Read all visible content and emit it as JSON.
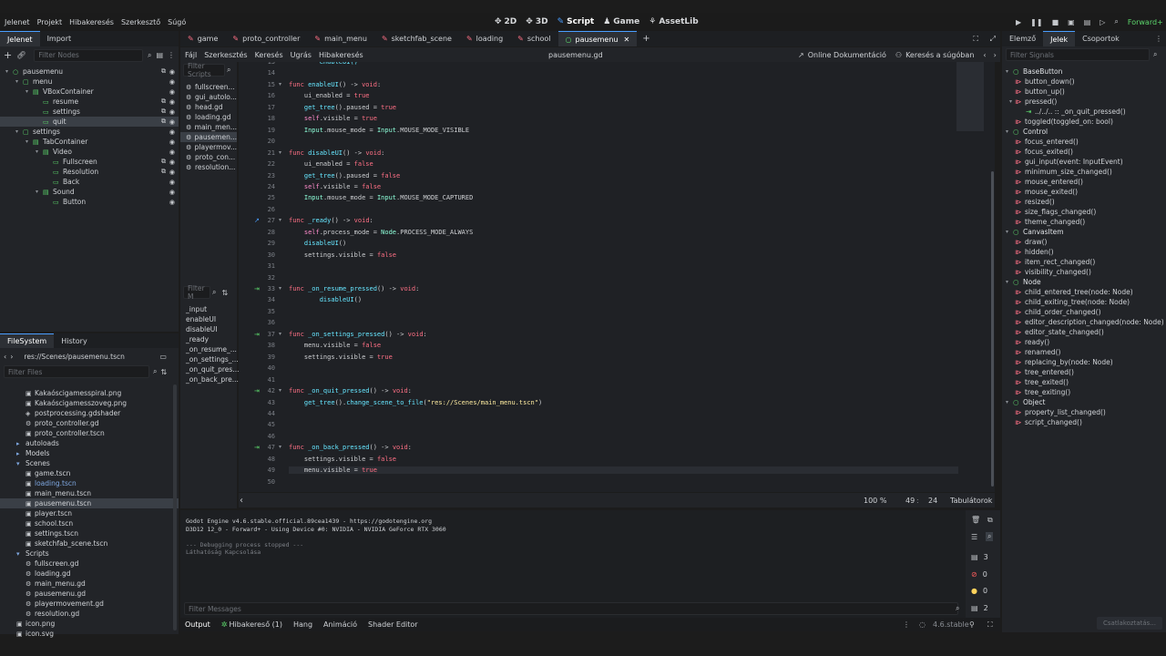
{
  "menu": [
    "Jelenet",
    "Projekt",
    "Hibakeresés",
    "Szerkesztő",
    "Súgó"
  ],
  "workspaces": [
    {
      "label": "2D",
      "icon": "✥"
    },
    {
      "label": "3D",
      "icon": "✥"
    },
    {
      "label": "Script",
      "icon": "✎"
    },
    {
      "label": "Game",
      "icon": "♟"
    },
    {
      "label": "AssetLib",
      "icon": "⚘"
    }
  ],
  "renderer": "Forward+",
  "left_tabs": [
    "Jelenet",
    "Import"
  ],
  "filter_nodes": "Filter Nodes",
  "scene_tree": [
    {
      "label": "pausemenu",
      "indent": 0,
      "icon": "○",
      "color": "#5cd66b"
    },
    {
      "label": "menu",
      "indent": 1,
      "icon": "▢",
      "color": "#5cd66b"
    },
    {
      "label": "VBoxContainer",
      "indent": 2,
      "icon": "▤",
      "color": "#5cd66b"
    },
    {
      "label": "resume",
      "indent": 3,
      "icon": "▭",
      "color": "#5cd66b"
    },
    {
      "label": "settings",
      "indent": 3,
      "icon": "▭",
      "color": "#5cd66b"
    },
    {
      "label": "quit",
      "indent": 3,
      "icon": "▭",
      "color": "#5cd66b",
      "selected": true
    },
    {
      "label": "settings",
      "indent": 1,
      "icon": "▢",
      "color": "#5cd66b"
    },
    {
      "label": "TabContainer",
      "indent": 2,
      "icon": "▤",
      "color": "#5cd66b"
    },
    {
      "label": "Video",
      "indent": 3,
      "icon": "▤",
      "color": "#5cd66b"
    },
    {
      "label": "Fullscreen",
      "indent": 4,
      "icon": "▭",
      "color": "#5cd66b"
    },
    {
      "label": "Resolution",
      "indent": 4,
      "icon": "▭",
      "color": "#5cd66b"
    },
    {
      "label": "Back",
      "indent": 4,
      "icon": "▭",
      "color": "#5cd66b"
    },
    {
      "label": "Sound",
      "indent": 3,
      "icon": "▤",
      "color": "#5cd66b"
    },
    {
      "label": "Button",
      "indent": 4,
      "icon": "▭",
      "color": "#5cd66b"
    }
  ],
  "fs_tabs": [
    "FileSystem",
    "History"
  ],
  "fs_path": "res://Scenes/pausemenu.tscn",
  "filter_files": "Filter Files",
  "fs_items": [
    {
      "label": "Kakaóscigamesspiral.png",
      "indent": 2,
      "icon": "▣"
    },
    {
      "label": "Kakaóscigamesszoveg.png",
      "indent": 2,
      "icon": "▣"
    },
    {
      "label": "postprocessing.gdshader",
      "indent": 2,
      "icon": "◈"
    },
    {
      "label": "proto_controller.gd",
      "indent": 2,
      "icon": "⚙"
    },
    {
      "label": "proto_controller.tscn",
      "indent": 2,
      "icon": "▣"
    },
    {
      "label": "autoloads",
      "indent": 1,
      "icon": "▸",
      "folder": true
    },
    {
      "label": "Models",
      "indent": 1,
      "icon": "▸",
      "folder": true
    },
    {
      "label": "Scenes",
      "indent": 1,
      "icon": "▾",
      "folder": true
    },
    {
      "label": "game.tscn",
      "indent": 2,
      "icon": "▣"
    },
    {
      "label": "loading.tscn",
      "indent": 2,
      "icon": "▣",
      "blue": true
    },
    {
      "label": "main_menu.tscn",
      "indent": 2,
      "icon": "▣"
    },
    {
      "label": "pausemenu.tscn",
      "indent": 2,
      "icon": "▣",
      "selected": true
    },
    {
      "label": "player.tscn",
      "indent": 2,
      "icon": "▣"
    },
    {
      "label": "school.tscn",
      "indent": 2,
      "icon": "▣"
    },
    {
      "label": "settings.tscn",
      "indent": 2,
      "icon": "▣"
    },
    {
      "label": "sketchfab_scene.tscn",
      "indent": 2,
      "icon": "▣"
    },
    {
      "label": "Scripts",
      "indent": 1,
      "icon": "▾",
      "folder": true
    },
    {
      "label": "fullscreen.gd",
      "indent": 2,
      "icon": "⚙"
    },
    {
      "label": "loading.gd",
      "indent": 2,
      "icon": "⚙"
    },
    {
      "label": "main_menu.gd",
      "indent": 2,
      "icon": "⚙"
    },
    {
      "label": "pausemenu.gd",
      "indent": 2,
      "icon": "⚙"
    },
    {
      "label": "playermovement.gd",
      "indent": 2,
      "icon": "⚙"
    },
    {
      "label": "resolution.gd",
      "indent": 2,
      "icon": "⚙"
    },
    {
      "label": "icon.png",
      "indent": 1,
      "icon": "▣"
    },
    {
      "label": "icon.svg",
      "indent": 1,
      "icon": "▣"
    }
  ],
  "scene_tabs": [
    "game",
    "proto_controller",
    "main_menu",
    "sketchfab_scene",
    "loading",
    "school",
    "pausemenu"
  ],
  "active_scene_tab": 6,
  "script_menu": [
    "Fájl",
    "Szerkesztés",
    "Keresés",
    "Ugrás",
    "Hibakeresés"
  ],
  "script_file": "pausemenu.gd",
  "online_docs": "Online Dokumentáció",
  "help_search": "Keresés a súgóban",
  "filter_scripts": "Filter Scripts",
  "scripts": [
    "fullscreen...",
    "gui_autolo...",
    "head.gd",
    "loading.gd",
    "main_men...",
    "pausemen...",
    "playermov...",
    "proto_con...",
    "resolution..."
  ],
  "active_script": 5,
  "filter_methods": "Filter M",
  "methods": [
    "_input",
    "enableUI",
    "disableUI",
    "_ready",
    "_on_resume_...",
    "_on_settings_...",
    "_on_quit_pres...",
    "_on_back_pre..."
  ],
  "code": [
    {
      "n": "13",
      "t": "        enableUI()",
      "cls": "fn"
    },
    {
      "n": "14",
      "t": ""
    },
    {
      "n": "15",
      "fold": true,
      "h": "<span class='kw'>func</span> <span class='fn'>enableUI</span>() -> <span class='kw'>void</span>:"
    },
    {
      "n": "16",
      "h": "    ui_enabled = <span class='kw'>true</span>"
    },
    {
      "n": "17",
      "h": "    <span class='fn'>get_tree</span>().paused = <span class='kw'>true</span>"
    },
    {
      "n": "18",
      "h": "    <span class='sf'>self</span>.visible = <span class='kw'>true</span>"
    },
    {
      "n": "19",
      "h": "    <span class='ty'>Input</span>.mouse_mode = <span class='ty'>Input</span>.MOUSE_MODE_VISIBLE"
    },
    {
      "n": "20",
      "t": ""
    },
    {
      "n": "21",
      "fold": true,
      "h": "<span class='kw'>func</span> <span class='fn'>disableUI</span>() -> <span class='kw'>void</span>:"
    },
    {
      "n": "22",
      "h": "    ui_enabled = <span class='kw'>false</span>"
    },
    {
      "n": "23",
      "h": "    <span class='fn'>get_tree</span>().paused = <span class='kw'>false</span>"
    },
    {
      "n": "24",
      "h": "    <span class='sf'>self</span>.visible = <span class='kw'>false</span>"
    },
    {
      "n": "25",
      "h": "    <span class='ty'>Input</span>.mouse_mode = <span class='ty'>Input</span>.MOUSE_MODE_CAPTURED"
    },
    {
      "n": "26",
      "t": ""
    },
    {
      "n": "27",
      "fold": true,
      "mark": "↗",
      "h": "<span class='kw'>func</span> <span class='fn'>_ready</span>() -> <span class='kw'>void</span>:"
    },
    {
      "n": "28",
      "h": "    <span class='sf'>self</span>.process_mode = <span class='ty'>Node</span>.PROCESS_MODE_ALWAYS"
    },
    {
      "n": "29",
      "h": "    <span class='fn'>disableUI</span>()"
    },
    {
      "n": "30",
      "h": "    settings.visible = <span class='kw'>false</span>"
    },
    {
      "n": "31",
      "t": ""
    },
    {
      "n": "32",
      "t": ""
    },
    {
      "n": "33",
      "fold": true,
      "mark": "⇥",
      "h": "<span class='kw'>func</span> <span class='fn'>_on_resume_pressed</span>() -> <span class='kw'>void</span>:"
    },
    {
      "n": "34",
      "h": "        <span class='fn'>disableUI</span>()"
    },
    {
      "n": "35",
      "t": ""
    },
    {
      "n": "36",
      "t": ""
    },
    {
      "n": "37",
      "fold": true,
      "mark": "⇥",
      "h": "<span class='kw'>func</span> <span class='fn'>_on_settings_pressed</span>() -> <span class='kw'>void</span>:"
    },
    {
      "n": "38",
      "h": "    menu.visible = <span class='kw'>false</span>"
    },
    {
      "n": "39",
      "h": "    settings.visible = <span class='kw'>true</span>"
    },
    {
      "n": "40",
      "t": ""
    },
    {
      "n": "41",
      "t": ""
    },
    {
      "n": "42",
      "fold": true,
      "mark": "⇥",
      "h": "<span class='kw'>func</span> <span class='fn'>_on_quit_pressed</span>() -> <span class='kw'>void</span>:"
    },
    {
      "n": "43",
      "h": "    <span class='fn'>get_tree</span>().<span class='fn'>change_scene_to_file</span>(<span class='st'>\"res://Scenes/main_menu.tscn\"</span>)"
    },
    {
      "n": "44",
      "t": ""
    },
    {
      "n": "45",
      "t": ""
    },
    {
      "n": "46",
      "t": ""
    },
    {
      "n": "47",
      "fold": true,
      "mark": "⇥",
      "h": "<span class='kw'>func</span> <span class='fn'>_on_back_pressed</span>() -> <span class='kw'>void</span>:"
    },
    {
      "n": "48",
      "h": "    settings.visible = <span class='kw'>false</span>"
    },
    {
      "n": "49",
      "cur": true,
      "h": "    menu.visible = <span class='kw'>true</span>"
    },
    {
      "n": "50",
      "t": ""
    }
  ],
  "status": {
    "zoom": "100 %",
    "line": "49",
    "col": "24",
    "indent": "Tabulátorok"
  },
  "output_lines": [
    "Godot Engine v4.6.stable.official.89cea1439 - https://godotengine.org",
    "D3D12 12_0 - Forward+ - Using Device #0: NVIDIA - NVIDIA GeForce RTX 3060",
    "",
    "--- Debugging process stopped ---",
    "Láthatóság Kapcsolása"
  ],
  "filter_messages": "Filter Messages",
  "counts": {
    "log": "3",
    "err": "0",
    "warn": "0",
    "info": "2"
  },
  "bottom_tabs": [
    "Output",
    "Hibakereső (1)",
    "Hang",
    "Animáció",
    "Shader Editor"
  ],
  "version": "4.6.stable",
  "right_tabs": [
    "Elemző",
    "Jelek",
    "Csoportok"
  ],
  "filter_signals": "Filter Signals",
  "signals": [
    {
      "label": "BaseButton",
      "cls": true
    },
    {
      "label": "button_down()"
    },
    {
      "label": "button_up()"
    },
    {
      "label": "pressed()",
      "expand": true
    },
    {
      "label": "../../.. :: _on_quit_pressed()",
      "conn": true
    },
    {
      "label": "toggled(toggled_on: bool)"
    },
    {
      "label": "Control",
      "cls": true
    },
    {
      "label": "focus_entered()"
    },
    {
      "label": "focus_exited()"
    },
    {
      "label": "gui_input(event: InputEvent)"
    },
    {
      "label": "minimum_size_changed()"
    },
    {
      "label": "mouse_entered()"
    },
    {
      "label": "mouse_exited()"
    },
    {
      "label": "resized()"
    },
    {
      "label": "size_flags_changed()"
    },
    {
      "label": "theme_changed()"
    },
    {
      "label": "CanvasItem",
      "cls": true
    },
    {
      "label": "draw()"
    },
    {
      "label": "hidden()"
    },
    {
      "label": "item_rect_changed()"
    },
    {
      "label": "visibility_changed()"
    },
    {
      "label": "Node",
      "cls": true
    },
    {
      "label": "child_entered_tree(node: Node)"
    },
    {
      "label": "child_exiting_tree(node: Node)"
    },
    {
      "label": "child_order_changed()"
    },
    {
      "label": "editor_description_changed(node: Node)"
    },
    {
      "label": "editor_state_changed()"
    },
    {
      "label": "ready()"
    },
    {
      "label": "renamed()"
    },
    {
      "label": "replacing_by(node: Node)"
    },
    {
      "label": "tree_entered()"
    },
    {
      "label": "tree_exited()"
    },
    {
      "label": "tree_exiting()"
    },
    {
      "label": "Object",
      "cls": true
    },
    {
      "label": "property_list_changed()"
    },
    {
      "label": "script_changed()"
    }
  ],
  "connect_btn": "Csatlakoztatás..."
}
